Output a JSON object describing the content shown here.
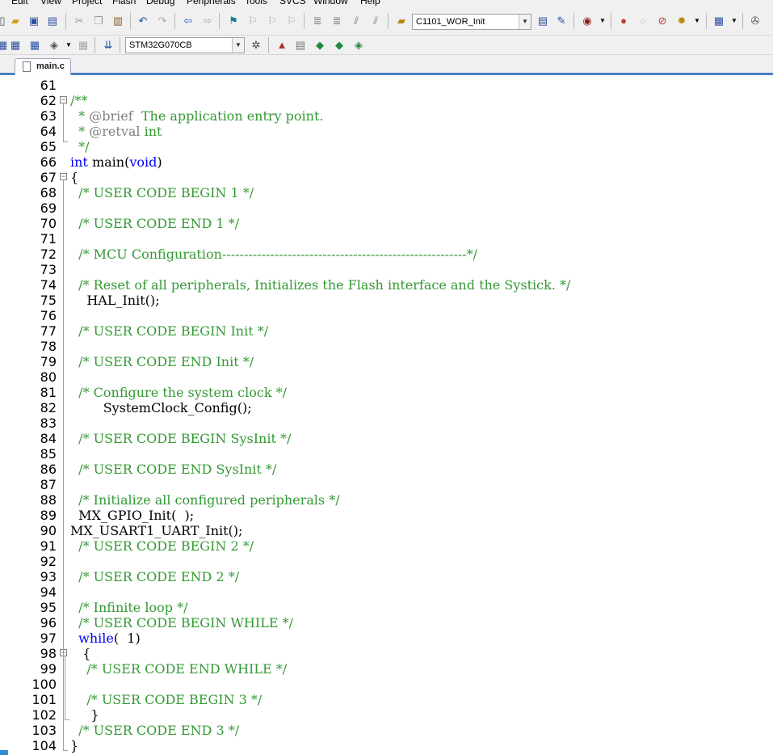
{
  "menubar": {
    "items": [
      "Edit",
      "View",
      "Project",
      "Flash",
      "Debug",
      "Peripherals",
      "Tools",
      "SVCS",
      "Window",
      "Help"
    ]
  },
  "toolbar1": {
    "target_combo": "C1101_WOR_Init"
  },
  "toolbar2": {
    "device_combo": "STM32G070CB"
  },
  "tabs": [
    {
      "label": "main.c",
      "active": true
    }
  ],
  "colors": {
    "comment": "#339933",
    "keyword": "#0000ff",
    "tag": "#808080",
    "accent": "#4a7fc8"
  },
  "editor": {
    "lines": [
      {
        "n": "61",
        "segs": []
      },
      {
        "n": "62",
        "fold": "minus",
        "segs": [
          {
            "t": "/**",
            "c": "comment"
          }
        ]
      },
      {
        "n": "63",
        "segs": [
          {
            "t": "  * ",
            "c": "comment"
          },
          {
            "t": "@brief",
            "c": "tag"
          },
          {
            "t": "  The application entry point.",
            "c": "comment"
          }
        ]
      },
      {
        "n": "64",
        "segs": [
          {
            "t": "  * ",
            "c": "comment"
          },
          {
            "t": "@retval",
            "c": "tag"
          },
          {
            "t": " int",
            "c": "comment"
          }
        ]
      },
      {
        "n": "65",
        "segs": [
          {
            "t": "  */",
            "c": "comment"
          }
        ]
      },
      {
        "n": "66",
        "segs": [
          {
            "t": "int",
            "c": "keyword"
          },
          {
            "t": " main(",
            "c": ""
          },
          {
            "t": "void",
            "c": "keyword"
          },
          {
            "t": ")",
            "c": ""
          }
        ]
      },
      {
        "n": "67",
        "fold": "minus",
        "segs": [
          {
            "t": "{",
            "c": ""
          }
        ]
      },
      {
        "n": "68",
        "segs": [
          {
            "t": "  /* USER CODE BEGIN 1 */",
            "c": "comment"
          }
        ]
      },
      {
        "n": "69",
        "segs": []
      },
      {
        "n": "70",
        "segs": [
          {
            "t": "  /* USER CODE END 1 */",
            "c": "comment"
          }
        ]
      },
      {
        "n": "71",
        "segs": []
      },
      {
        "n": "72",
        "segs": [
          {
            "t": "  /* MCU Configuration--------------------------------------------------------*/",
            "c": "comment"
          }
        ]
      },
      {
        "n": "73",
        "segs": []
      },
      {
        "n": "74",
        "segs": [
          {
            "t": "  /* Reset of all peripherals, Initializes the Flash interface and the Systick. */",
            "c": "comment"
          }
        ]
      },
      {
        "n": "75",
        "segs": [
          {
            "t": "    HAL_Init();",
            "c": ""
          }
        ]
      },
      {
        "n": "76",
        "segs": []
      },
      {
        "n": "77",
        "segs": [
          {
            "t": "  /* USER CODE BEGIN Init */",
            "c": "comment"
          }
        ]
      },
      {
        "n": "78",
        "segs": []
      },
      {
        "n": "79",
        "segs": [
          {
            "t": "  /* USER CODE END Init */",
            "c": "comment"
          }
        ]
      },
      {
        "n": "80",
        "segs": []
      },
      {
        "n": "81",
        "segs": [
          {
            "t": "  /* Configure the system clock */",
            "c": "comment"
          }
        ]
      },
      {
        "n": "82",
        "segs": [
          {
            "t": "        SystemClock_Config();",
            "c": ""
          }
        ]
      },
      {
        "n": "83",
        "segs": []
      },
      {
        "n": "84",
        "segs": [
          {
            "t": "  /* USER CODE BEGIN SysInit */",
            "c": "comment"
          }
        ]
      },
      {
        "n": "85",
        "segs": []
      },
      {
        "n": "86",
        "segs": [
          {
            "t": "  /* USER CODE END SysInit */",
            "c": "comment"
          }
        ]
      },
      {
        "n": "87",
        "segs": []
      },
      {
        "n": "88",
        "segs": [
          {
            "t": "  /* Initialize all configured peripherals */",
            "c": "comment"
          }
        ]
      },
      {
        "n": "89",
        "segs": [
          {
            "t": "  MX_GPIO_Init(  );",
            "c": ""
          }
        ]
      },
      {
        "n": "90",
        "segs": [
          {
            "t": "MX_USART1_UART_Init();",
            "c": ""
          }
        ]
      },
      {
        "n": "91",
        "segs": [
          {
            "t": "  /* USER CODE BEGIN 2 */",
            "c": "comment"
          }
        ]
      },
      {
        "n": "92",
        "segs": []
      },
      {
        "n": "93",
        "segs": [
          {
            "t": "  /* USER CODE END 2 */",
            "c": "comment"
          }
        ]
      },
      {
        "n": "94",
        "segs": []
      },
      {
        "n": "95",
        "segs": [
          {
            "t": "  /* Infinite loop */",
            "c": "comment"
          }
        ]
      },
      {
        "n": "96",
        "segs": [
          {
            "t": "  /* USER CODE BEGIN WHILE */",
            "c": "comment"
          }
        ]
      },
      {
        "n": "97",
        "segs": [
          {
            "t": "  while",
            "c": "keyword"
          },
          {
            "t": "(  1)",
            "c": ""
          }
        ]
      },
      {
        "n": "98",
        "fold": "minus",
        "segs": [
          {
            "t": "   {",
            "c": ""
          }
        ]
      },
      {
        "n": "99",
        "segs": [
          {
            "t": "    /* USER CODE END WHILE */",
            "c": "comment"
          }
        ]
      },
      {
        "n": "100",
        "segs": []
      },
      {
        "n": "101",
        "segs": [
          {
            "t": "    /* USER CODE BEGIN 3 */",
            "c": "comment"
          }
        ]
      },
      {
        "n": "102",
        "segs": [
          {
            "t": "     }",
            "c": ""
          }
        ]
      },
      {
        "n": "103",
        "segs": [
          {
            "t": "  /* USER CODE END 3 */",
            "c": "comment"
          }
        ]
      },
      {
        "n": "104",
        "segs": [
          {
            "t": "}",
            "c": ""
          }
        ]
      }
    ]
  }
}
